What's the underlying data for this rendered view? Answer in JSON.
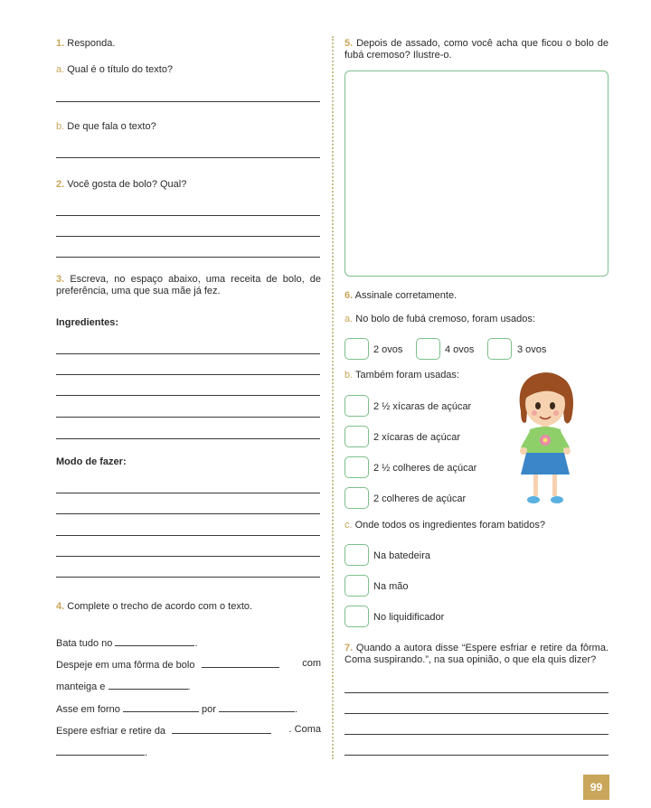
{
  "q1": {
    "num": "1.",
    "text": "Responda.",
    "a_letter": "a.",
    "a_text": "Qual é o título do texto?",
    "b_letter": "b.",
    "b_text": "De que fala o texto?"
  },
  "q2": {
    "num": "2.",
    "text": "Você gosta de bolo? Qual?"
  },
  "q3": {
    "num": "3.",
    "text": "Escreva, no espaço abaixo, uma receita de bolo, de preferência, uma que sua mãe já fez.",
    "ingredientes": "Ingredientes:",
    "modo": "Modo de fazer:"
  },
  "q4": {
    "num": "4.",
    "text": "Complete o trecho de acordo com o texto.",
    "l1a": "Bata tudo no",
    "l1b": ".",
    "l2a": "Despeje em uma fôrma de bolo",
    "l2b": "com",
    "l3a": "manteiga e",
    "l3b": ".",
    "l4a": "Asse em forno",
    "l4b": "por",
    "l4c": ".",
    "l5a": "Espere esfriar e retire da",
    "l5b": ". Coma",
    "l6": "."
  },
  "q5": {
    "num": "5.",
    "text": "Depois de assado, como você acha que ficou o bolo de fubá cremoso? Ilustre-o."
  },
  "q6": {
    "num": "6.",
    "text": "Assinale corretamente.",
    "a_letter": "a.",
    "a_text": "No bolo de fubá cremoso, foram usados:",
    "a_opts": [
      "2 ovos",
      "4 ovos",
      "3 ovos"
    ],
    "b_letter": "b.",
    "b_text": "Também foram usadas:",
    "b_opts": [
      "2 ½ xícaras de açúcar",
      "2 xícaras de açúcar",
      "2 ½ colheres de açúcar",
      "2 colheres de açúcar"
    ],
    "c_letter": "c.",
    "c_text": "Onde todos os ingredientes foram batidos?",
    "c_opts": [
      "Na batedeira",
      "Na mão",
      "No liquidificador"
    ]
  },
  "q7": {
    "num": "7.",
    "text": "Quando a autora disse “Espere esfriar e retire da fôrma. Coma suspirando.”, na sua opinião, o que ela quis dizer?"
  },
  "page_number": "99",
  "colors": {
    "accent": "#c9a65a",
    "box_border": "#7cc08a"
  }
}
